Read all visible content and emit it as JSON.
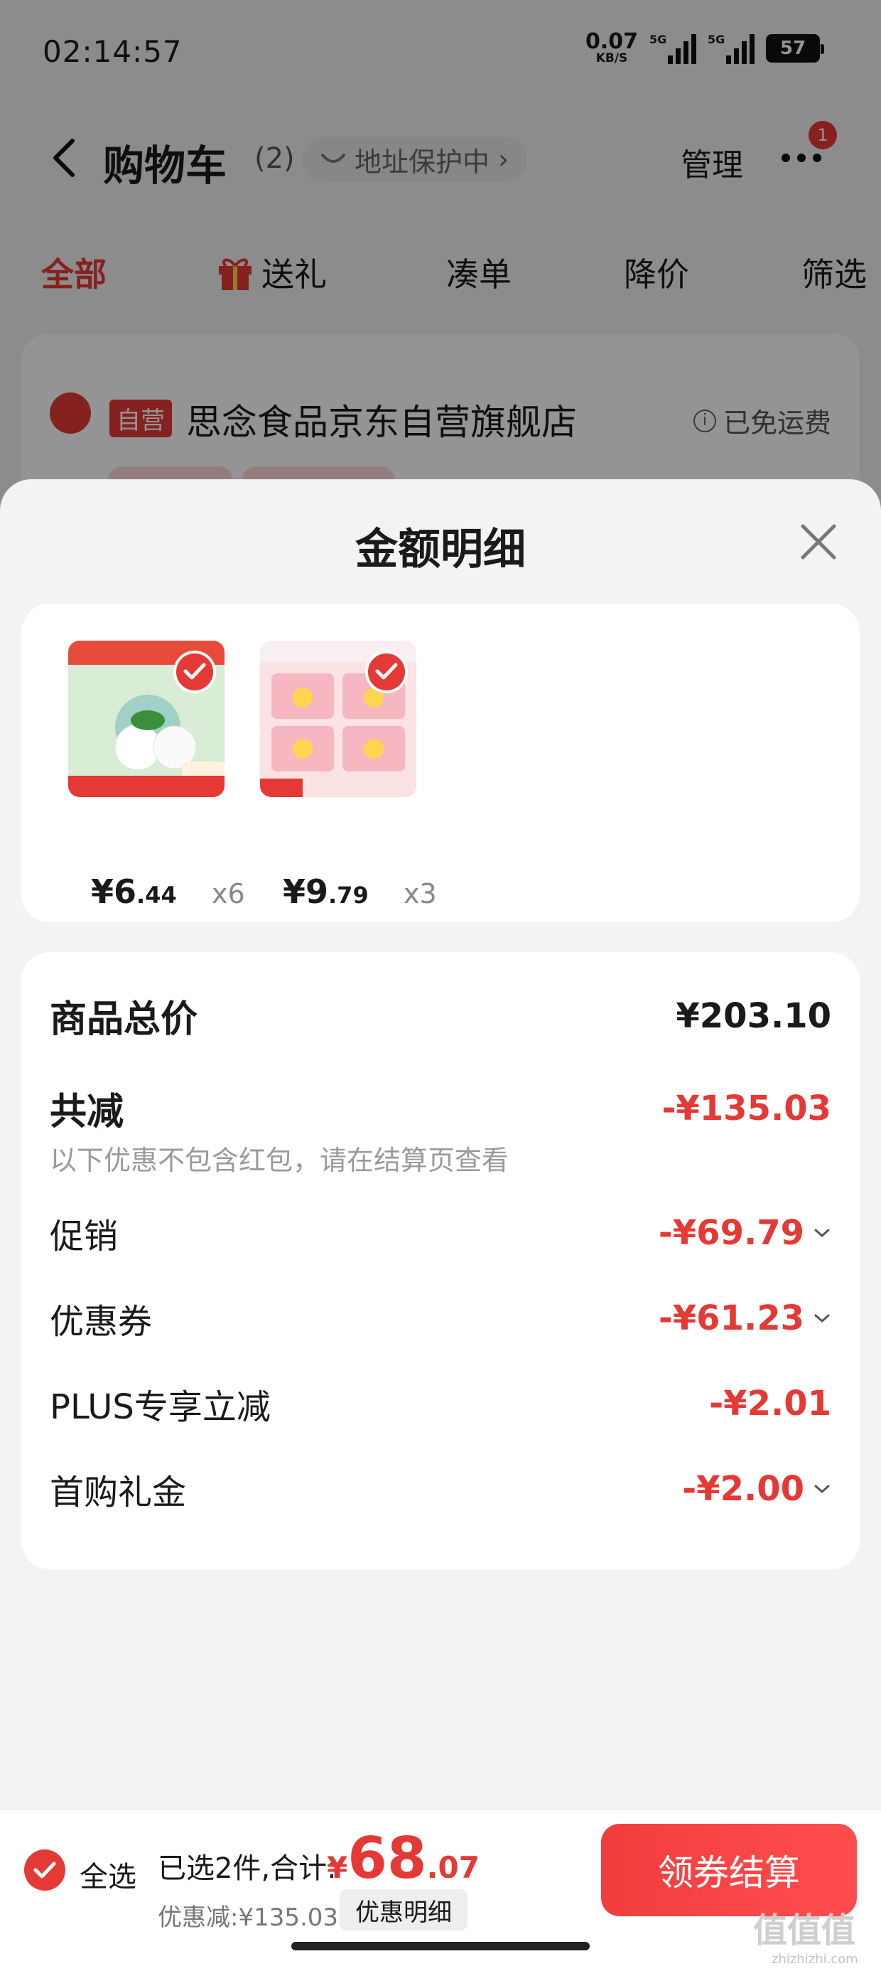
{
  "status_bar": {
    "time": "02:14:57",
    "net_speed": "0.07",
    "net_unit": "KB/S",
    "signal_1": "5G",
    "signal_2": "5G",
    "battery": "57"
  },
  "nav": {
    "title": "购物车",
    "count": "(2)",
    "address_chip": "地址保护中",
    "manage": "管理",
    "badge": "1"
  },
  "filter_tabs": [
    "全部",
    "送礼",
    "凑单",
    "降价",
    "筛选"
  ],
  "shop": {
    "tag": "自营",
    "name": "思念食品京东自营旗舰店",
    "freight": "已免运费"
  },
  "sheet": {
    "title": "金额明细",
    "products": [
      {
        "price_int": "¥6",
        "price_dec": ".44",
        "qty": "x6",
        "thumb_desc": "咸口味的大汤团"
      },
      {
        "price_int": "¥9",
        "price_dec": ".79",
        "qty": "x3",
        "thumb_desc": "高定香氛小苍兰"
      }
    ],
    "summary": {
      "total_label": "商品总价",
      "total_value": "¥203.10",
      "reduce_label": "共减",
      "reduce_value": "-¥135.03",
      "note": "以下优惠不包含红包，请在结算页查看",
      "items": [
        {
          "label": "促销",
          "value": "-¥69.79",
          "expandable": true
        },
        {
          "label": "优惠券",
          "value": "-¥61.23",
          "expandable": true
        },
        {
          "label": "PLUS专享立减",
          "value": "-¥2.01",
          "expandable": false
        },
        {
          "label": "首购礼金",
          "value": "-¥2.00",
          "expandable": true
        }
      ]
    }
  },
  "checkout": {
    "select_all": "全选",
    "selected_text": "已选2件,合计:",
    "total_symbol": "¥",
    "total_int": "68",
    "total_dec": ".07",
    "discount_text": "优惠减:¥135.03",
    "detail_button": "优惠明细",
    "checkout_button": "领券结算",
    "watermark": "值值值",
    "watermark_url": "zhizhizhi.com"
  },
  "colors": {
    "accent": "#e53935",
    "sheet_bg": "#f3f3f3",
    "card_bg": "#ffffff"
  }
}
